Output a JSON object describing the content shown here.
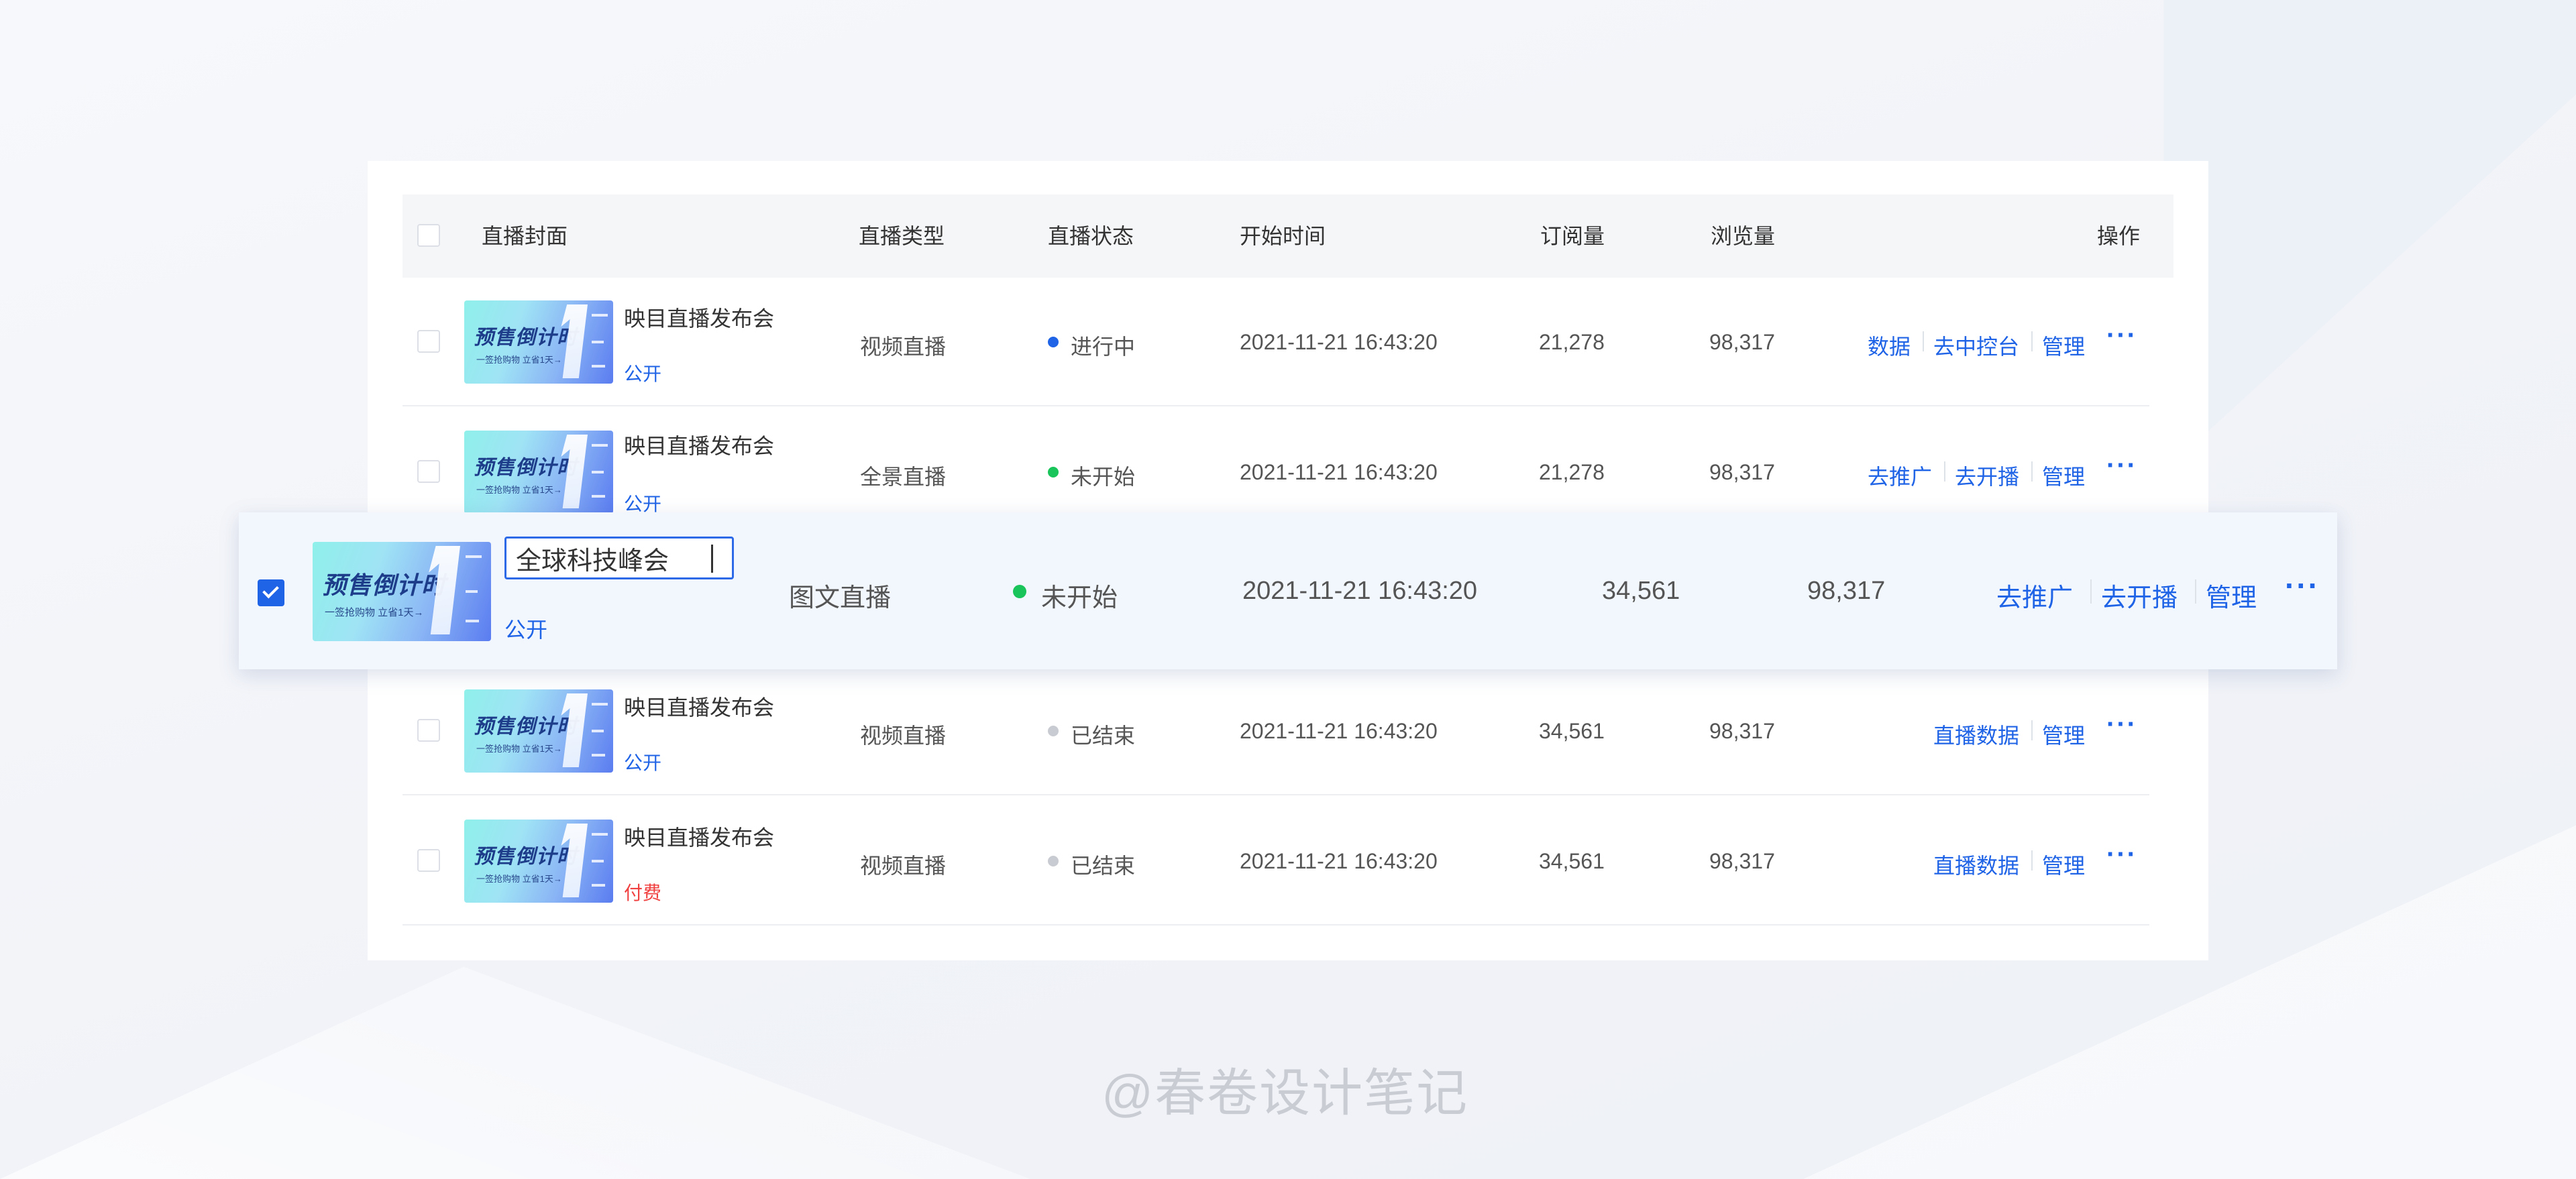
{
  "colors": {
    "accent": "#1f63e6",
    "paid": "#f04040",
    "status_live": "#1f63e6",
    "status_upcoming": "#19c45a",
    "status_ended": "#c8cbd1"
  },
  "header": {
    "cover": "直播封面",
    "type": "直播类型",
    "status": "直播状态",
    "start_time": "开始时间",
    "subscriptions": "订阅量",
    "views": "浏览量",
    "actions": "操作"
  },
  "cover_art": {
    "title": "预售倒计时",
    "subtitle": "一签抢购物 立省1天→"
  },
  "rows": [
    {
      "title": "映目直播发布会",
      "badge": "公开",
      "type": "视频直播",
      "status": "进行中",
      "start_time": "2021-11-21 16:43:20",
      "subscriptions": "21,278",
      "views": "98,317",
      "actions": [
        "数据",
        "去中控台",
        "管理"
      ],
      "more": "···"
    },
    {
      "title": "映目直播发布会",
      "badge": "公开",
      "type": "全景直播",
      "status": "未开始",
      "start_time": "2021-11-21 16:43:20",
      "subscriptions": "21,278",
      "views": "98,317",
      "actions": [
        "去推广",
        "去开播",
        "管理"
      ],
      "more": "···"
    },
    {
      "title_input_value": "全球科技峰会",
      "badge": "公开",
      "type": "图文直播",
      "status": "未开始",
      "start_time": "2021-11-21 16:43:20",
      "subscriptions": "34,561",
      "views": "98,317",
      "actions": [
        "去推广",
        "去开播",
        "管理"
      ],
      "more": "···"
    },
    {
      "title": "映目直播发布会",
      "badge": "公开",
      "type": "视频直播",
      "status": "已结束",
      "start_time": "2021-11-21 16:43:20",
      "subscriptions": "34,561",
      "views": "98,317",
      "actions": [
        "直播数据",
        "管理"
      ],
      "more": "···"
    },
    {
      "title": "映目直播发布会",
      "badge": "付费",
      "type": "视频直播",
      "status": "已结束",
      "start_time": "2021-11-21 16:43:20",
      "subscriptions": "34,561",
      "views": "98,317",
      "actions": [
        "直播数据",
        "管理"
      ],
      "more": "···"
    }
  ],
  "watermark": "@春卷设计笔记"
}
